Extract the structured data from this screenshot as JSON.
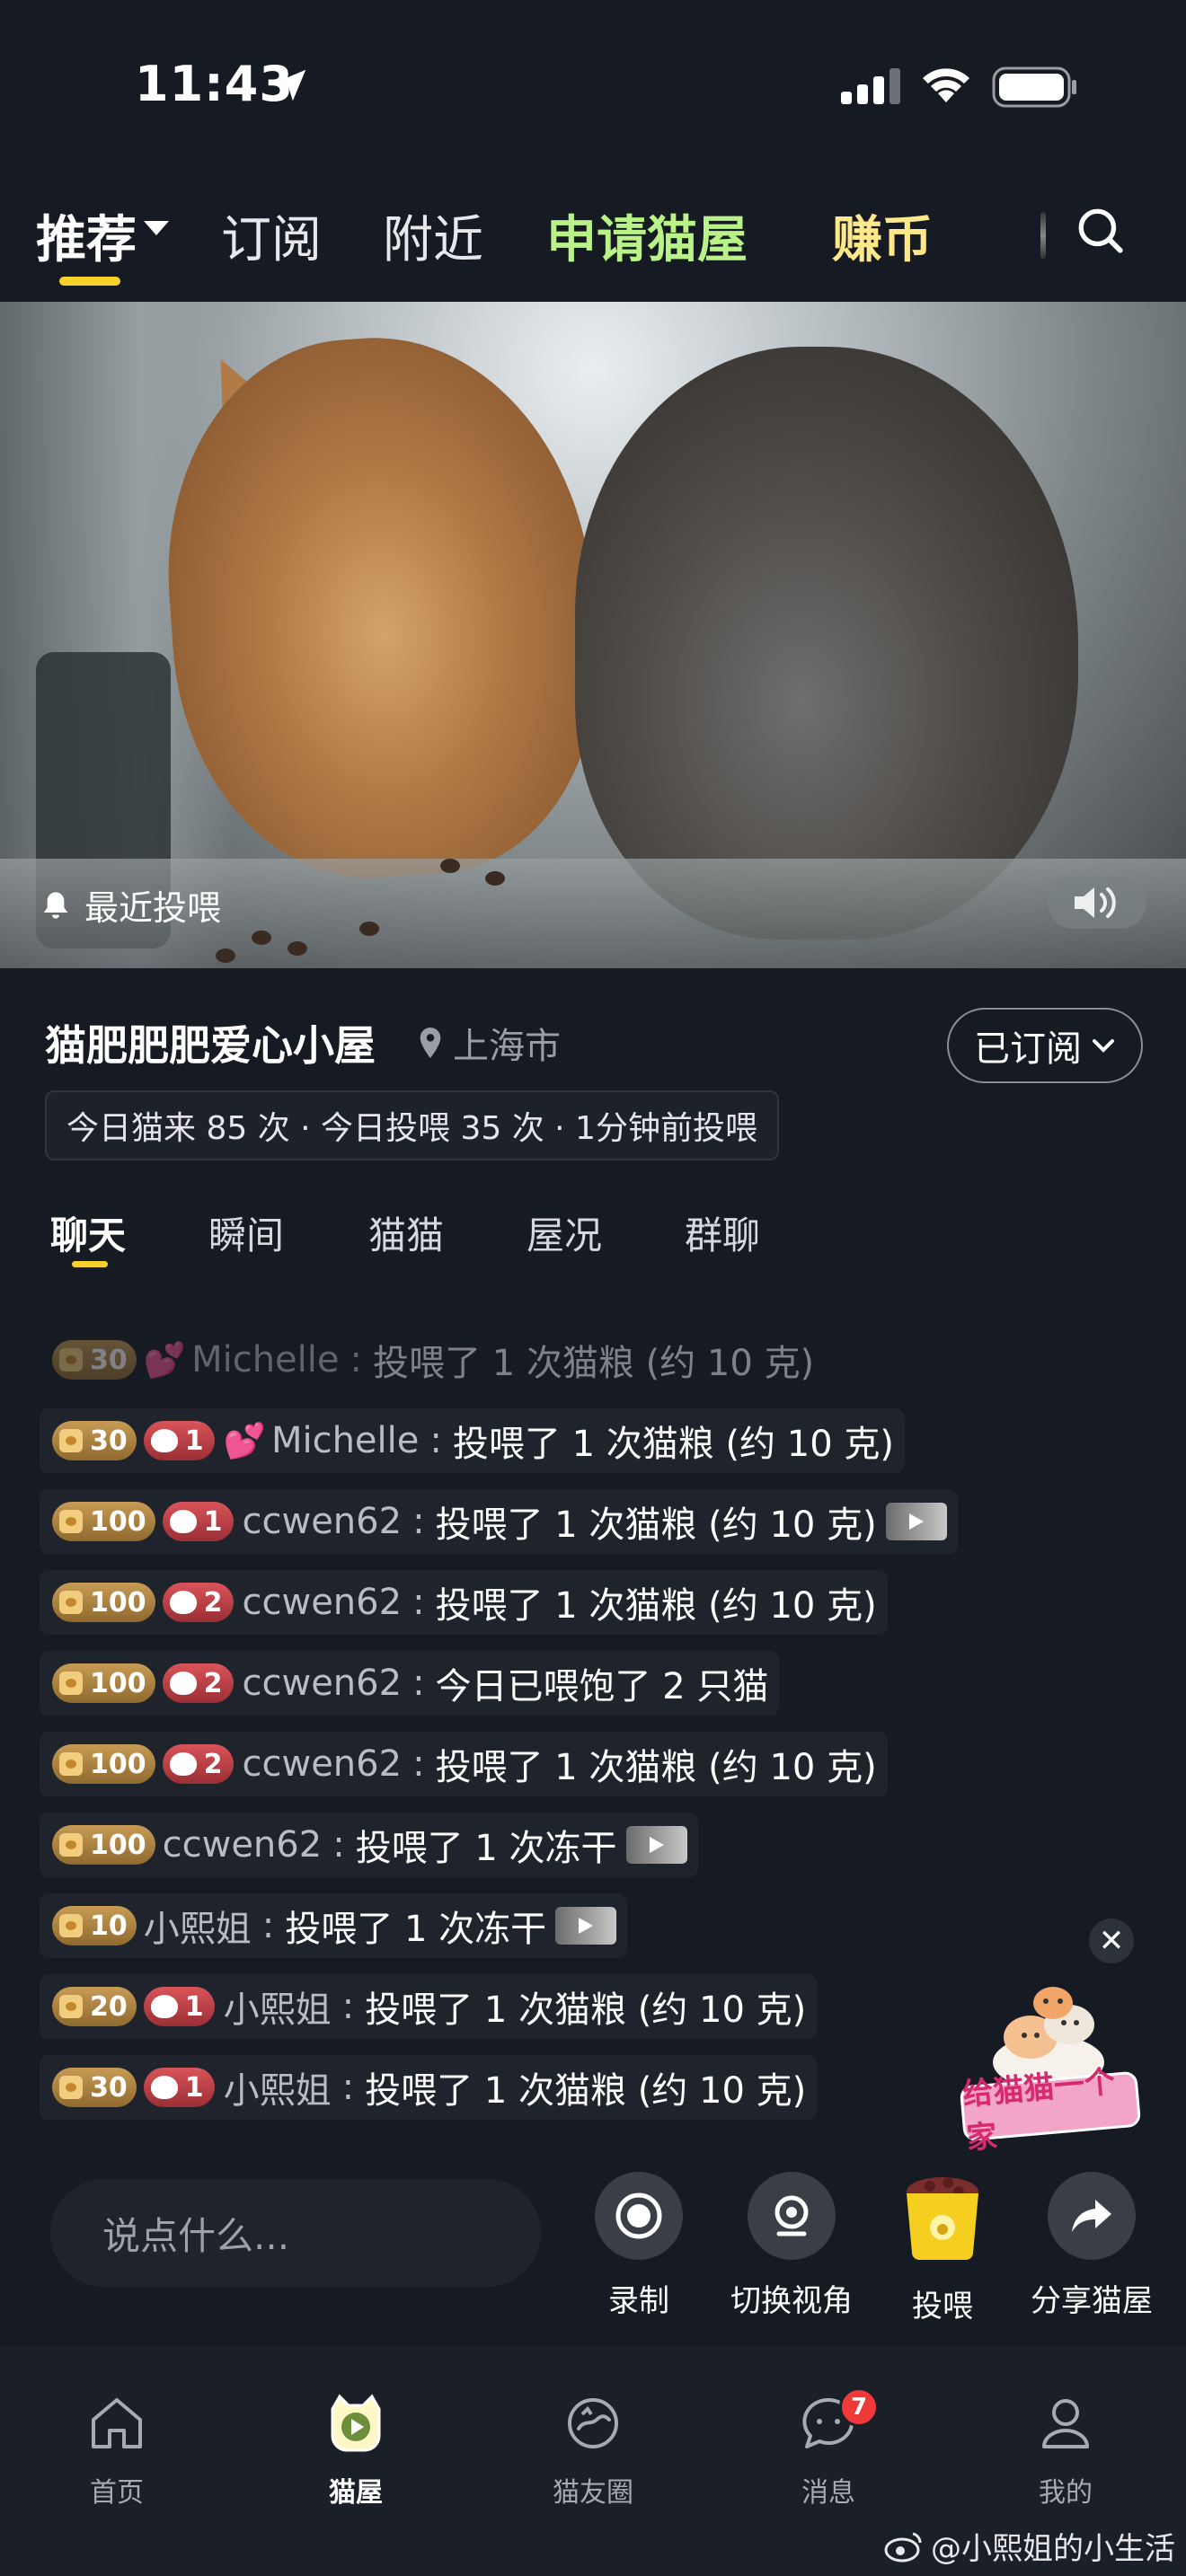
{
  "status_bar": {
    "time": "11:43"
  },
  "top_tabs": {
    "items": [
      "推荐",
      "订阅",
      "附近",
      "申请猫屋",
      "赚币"
    ],
    "active": "推荐"
  },
  "video": {
    "recent_feed_label": "最近投喂"
  },
  "room": {
    "title": "猫肥肥肥爱心小屋",
    "location": "上海市",
    "subscribe_label": "已订阅",
    "stats": "今日猫来 85 次 · 今日投喂 35 次 · 1分钟前投喂"
  },
  "sub_tabs": [
    "聊天",
    "瞬间",
    "猫猫",
    "屋况",
    "群聊"
  ],
  "chat": [
    {
      "level": "30",
      "cat": "",
      "heart": "💕",
      "user": "Michelle",
      "text": "投喂了 1 次猫粮 (约 10 克)",
      "video": false,
      "faded": true
    },
    {
      "level": "30",
      "cat": "1",
      "heart": "💕",
      "user": "Michelle",
      "text": "投喂了 1 次猫粮 (约 10 克)",
      "video": false,
      "faded": false
    },
    {
      "level": "100",
      "cat": "1",
      "heart": "",
      "user": "ccwen62",
      "text": "投喂了 1 次猫粮 (约 10 克)",
      "video": true,
      "faded": false
    },
    {
      "level": "100",
      "cat": "2",
      "heart": "",
      "user": "ccwen62",
      "text": "投喂了 1 次猫粮 (约 10 克)",
      "video": false,
      "faded": false
    },
    {
      "level": "100",
      "cat": "2",
      "heart": "",
      "user": "ccwen62",
      "text": "今日已喂饱了 2 只猫",
      "video": false,
      "faded": false
    },
    {
      "level": "100",
      "cat": "2",
      "heart": "",
      "user": "ccwen62",
      "text": "投喂了 1 次猫粮 (约 10 克)",
      "video": false,
      "faded": false
    },
    {
      "level": "100",
      "cat": "",
      "heart": "",
      "user": "ccwen62",
      "text": "投喂了 1 次冻干",
      "video": true,
      "faded": false
    },
    {
      "level": "10",
      "cat": "",
      "heart": "",
      "user": "小熙姐",
      "text": "投喂了 1 次冻干",
      "video": true,
      "faded": false
    },
    {
      "level": "20",
      "cat": "1",
      "heart": "",
      "user": "小熙姐",
      "text": "投喂了 1 次猫粮 (约 10 克)",
      "video": false,
      "faded": false
    },
    {
      "level": "30",
      "cat": "1",
      "heart": "",
      "user": "小熙姐",
      "text": "投喂了 1 次猫粮 (约 10 克)",
      "video": false,
      "faded": false
    }
  ],
  "promo": {
    "text": "给猫猫一个家",
    "close": "✕"
  },
  "composer": {
    "placeholder": "说点什么..."
  },
  "actions": [
    {
      "label": "录制",
      "icon": "record-icon"
    },
    {
      "label": "切换视角",
      "icon": "camera-switch-icon"
    },
    {
      "label": "投喂",
      "icon": "feed-bag-icon"
    },
    {
      "label": "分享猫屋",
      "icon": "share-icon"
    }
  ],
  "bottom_nav": {
    "items": [
      {
        "label": "首页",
        "icon": "home-icon"
      },
      {
        "label": "猫屋",
        "icon": "cat-house-icon"
      },
      {
        "label": "猫友圈",
        "icon": "cat-circle-icon"
      },
      {
        "label": "消息",
        "icon": "message-icon",
        "badge": "7"
      },
      {
        "label": "我的",
        "icon": "profile-icon"
      }
    ],
    "active": "猫屋"
  },
  "watermark": "@小熙姐的小生活",
  "colors": {
    "accent": "#f8d22a",
    "green_tab": "#b9f287",
    "gold_tab": "#ffe88a",
    "badge_red": "#f03a3a",
    "background": "#161a22"
  }
}
